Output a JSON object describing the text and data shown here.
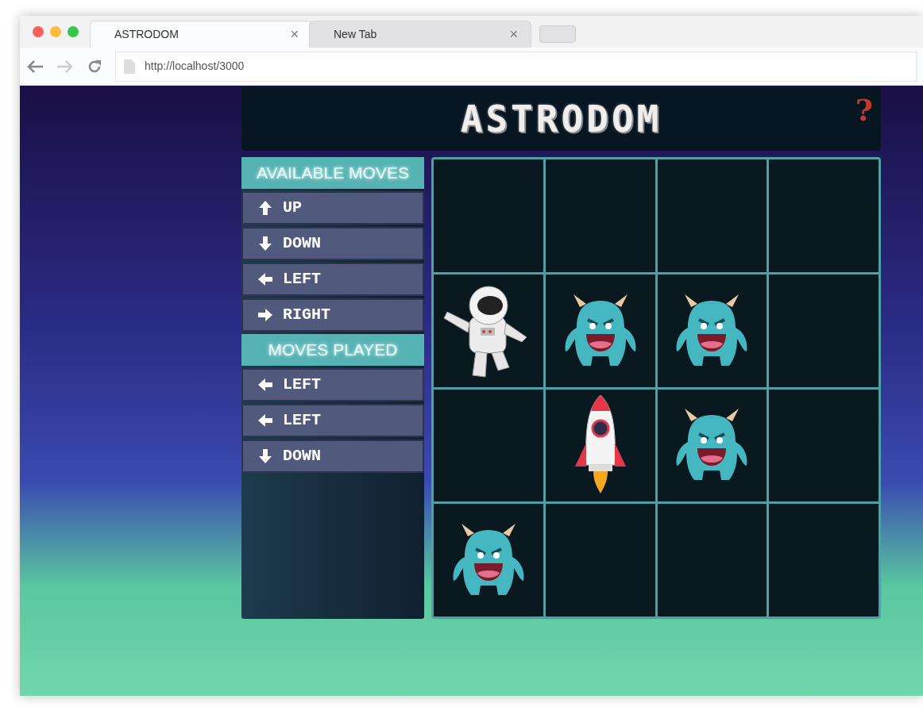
{
  "window": {
    "tabs": [
      {
        "label": "ASTRODOM",
        "selected": true,
        "close": "×"
      },
      {
        "label": "New Tab",
        "selected": false,
        "close": "×"
      }
    ],
    "address": "http://localhost/3000"
  },
  "header": {
    "title": "ASTRODOM",
    "help": "?"
  },
  "available_moves": {
    "title": "AVAILABLE MOVES",
    "items": [
      {
        "kind": "up",
        "label": "UP"
      },
      {
        "kind": "down",
        "label": "DOWN"
      },
      {
        "kind": "left",
        "label": "LEFT"
      },
      {
        "kind": "right",
        "label": "RIGHT"
      }
    ]
  },
  "moves_played": {
    "title": "MOVES PLAYED",
    "items": [
      {
        "kind": "left",
        "label": "LEFT"
      },
      {
        "kind": "left",
        "label": "LEFT"
      },
      {
        "kind": "down",
        "label": "DOWN"
      }
    ]
  },
  "board": {
    "rows": [
      [
        {
          "kind": "empty"
        },
        {
          "kind": "empty"
        },
        {
          "kind": "empty"
        },
        {
          "kind": "empty"
        }
      ],
      [
        {
          "kind": "astronaut"
        },
        {
          "kind": "monster"
        },
        {
          "kind": "monster"
        },
        {
          "kind": "empty"
        }
      ],
      [
        {
          "kind": "empty"
        },
        {
          "kind": "rocket"
        },
        {
          "kind": "monster"
        },
        {
          "kind": "empty"
        }
      ],
      [
        {
          "kind": "monster"
        },
        {
          "kind": "empty"
        },
        {
          "kind": "empty"
        },
        {
          "kind": "empty"
        }
      ]
    ]
  }
}
